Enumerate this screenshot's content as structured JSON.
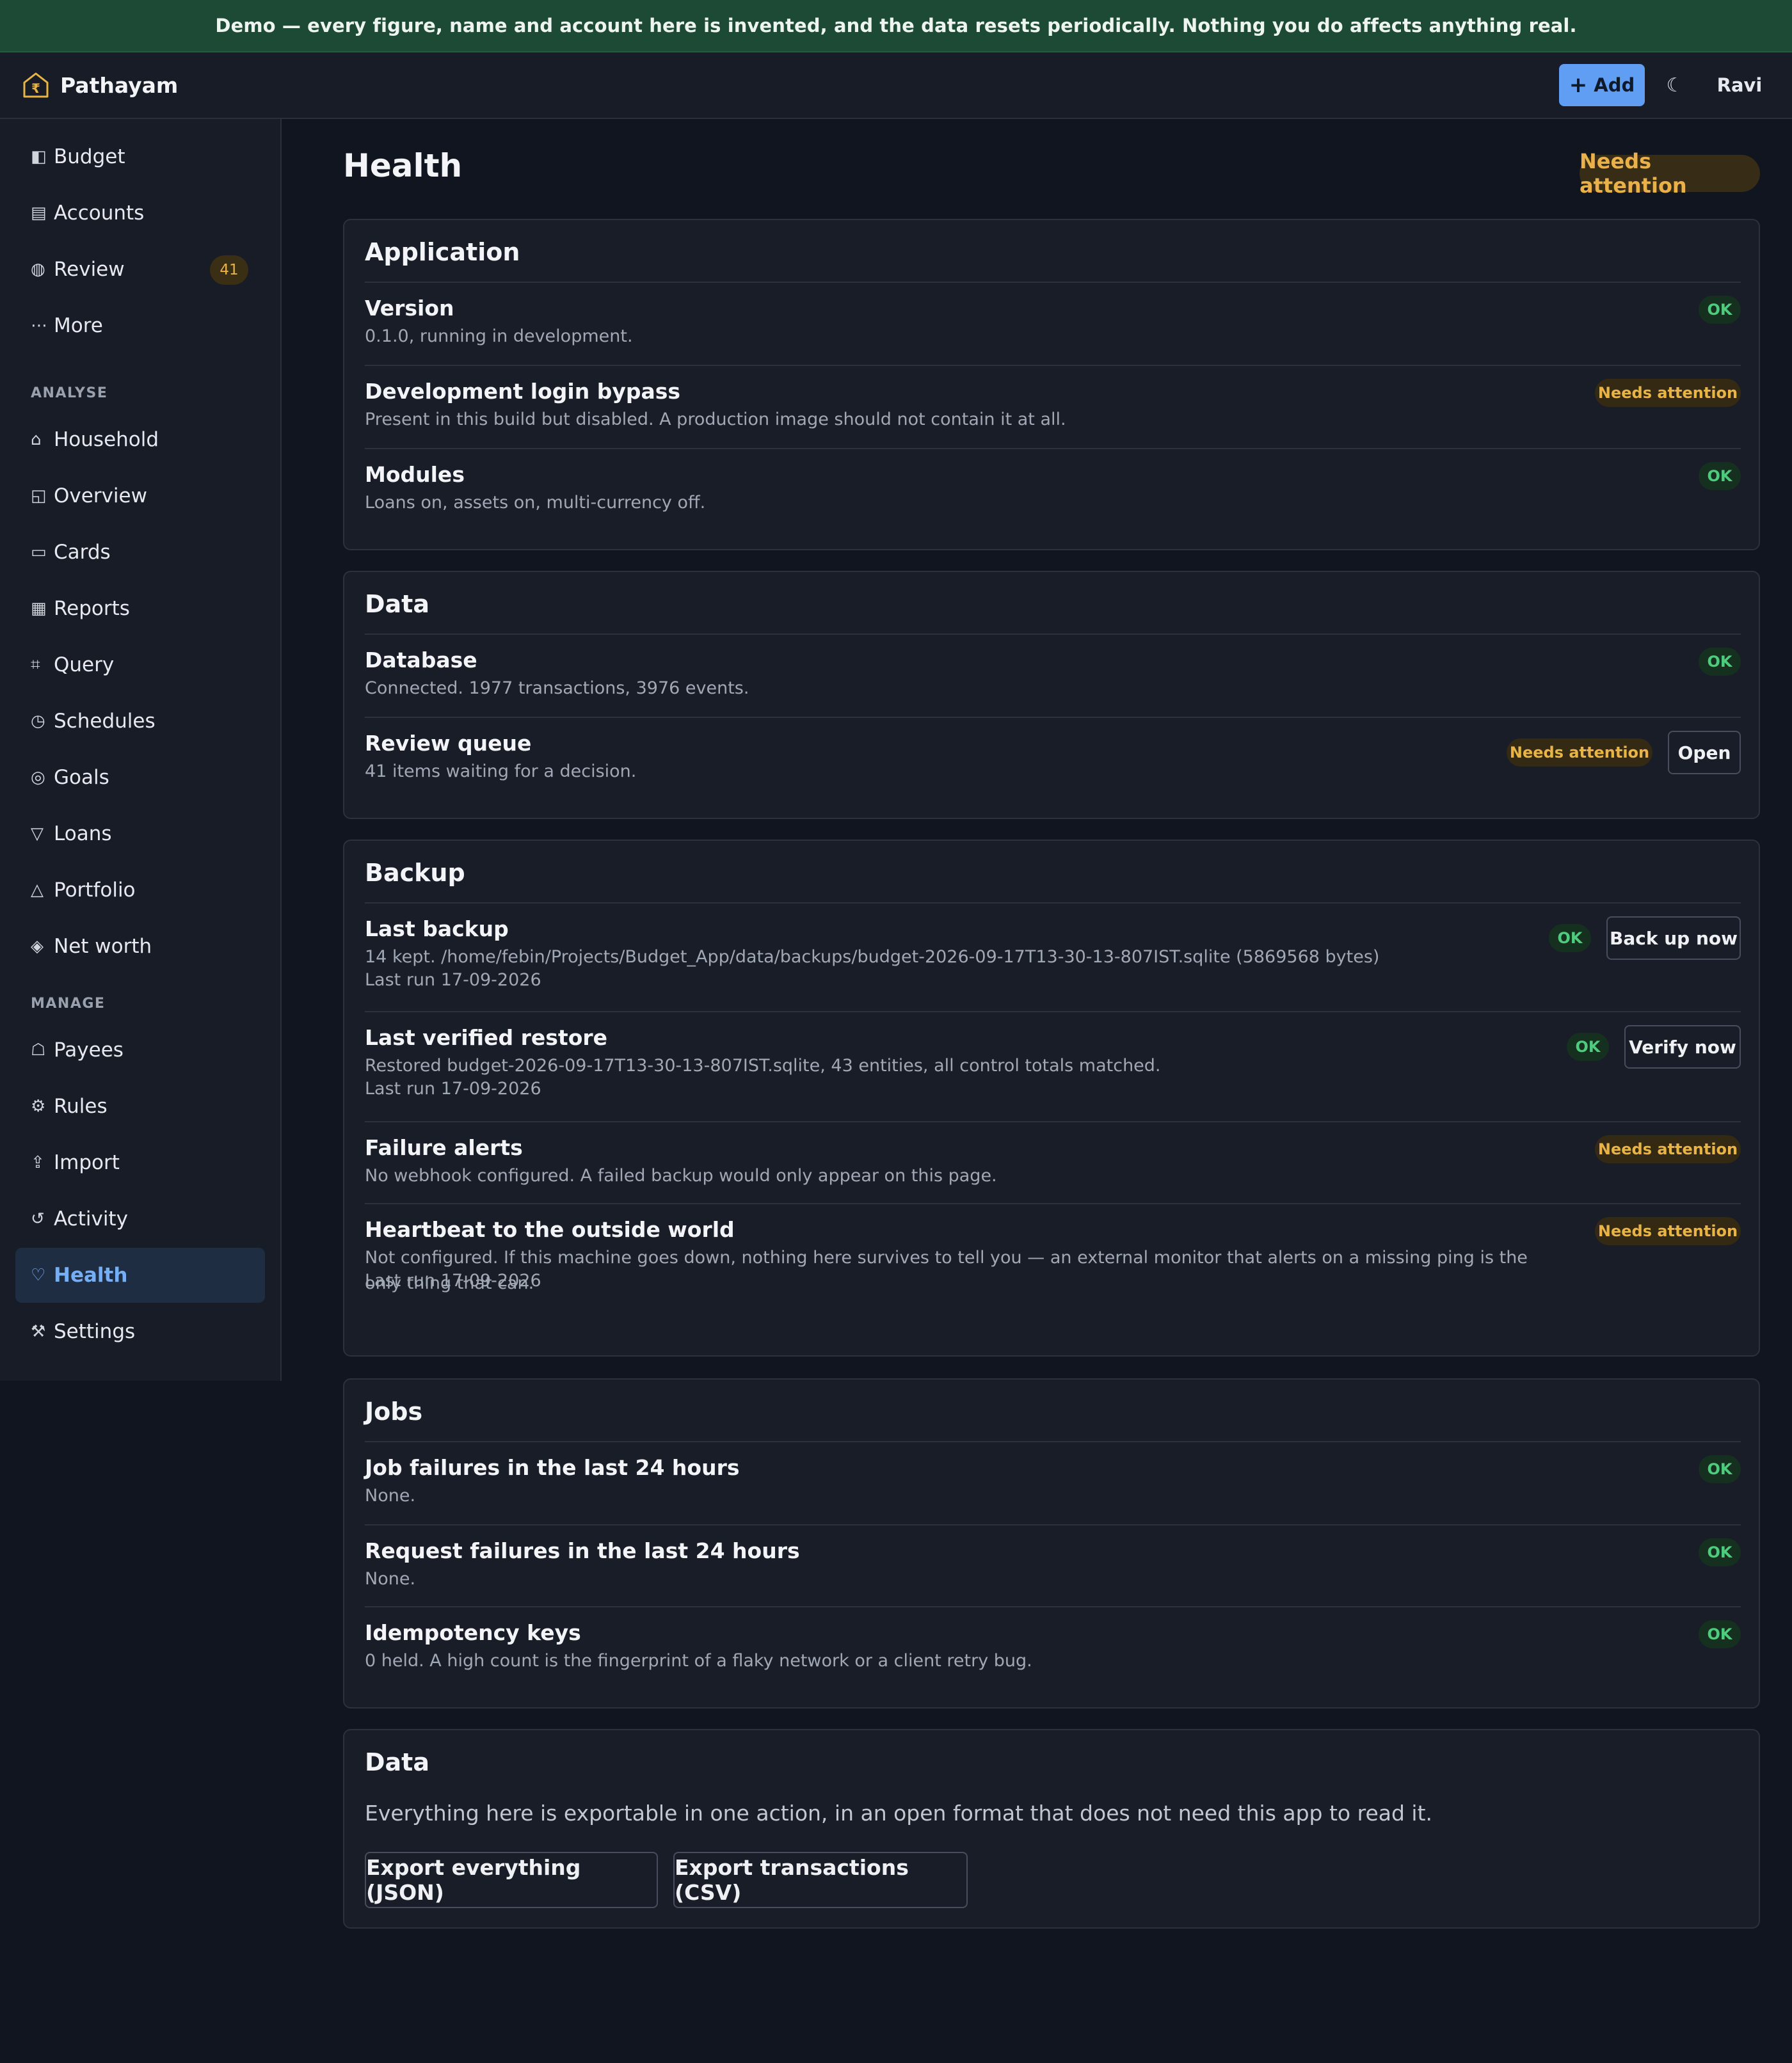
{
  "banner": "Demo — every figure, name and account here is invented, and the data resets periodically. Nothing you do affects anything real.",
  "topbar": {
    "brand": "Pathayam",
    "brand_icon": "house-rupee-icon",
    "add_label": "Add",
    "theme_icon": "☾",
    "user": "Ravi"
  },
  "sidebar": {
    "primary": [
      {
        "icon": "◧",
        "label": "Budget"
      },
      {
        "icon": "▤",
        "label": "Accounts"
      },
      {
        "icon": "◍",
        "label": "Review",
        "badge": "41"
      },
      {
        "icon": "⋯",
        "label": "More"
      }
    ],
    "analyse_label": "ANALYSE",
    "analyse": [
      {
        "icon": "⌂",
        "label": "Household"
      },
      {
        "icon": "◱",
        "label": "Overview"
      },
      {
        "icon": "▭",
        "label": "Cards"
      },
      {
        "icon": "▦",
        "label": "Reports"
      },
      {
        "icon": "⌗",
        "label": "Query"
      },
      {
        "icon": "◷",
        "label": "Schedules"
      },
      {
        "icon": "◎",
        "label": "Goals"
      },
      {
        "icon": "▽",
        "label": "Loans"
      },
      {
        "icon": "△",
        "label": "Portfolio"
      },
      {
        "icon": "◈",
        "label": "Net worth"
      }
    ],
    "manage_label": "MANAGE",
    "manage": [
      {
        "icon": "☖",
        "label": "Payees"
      },
      {
        "icon": "⚙",
        "label": "Rules"
      },
      {
        "icon": "⇪",
        "label": "Import"
      },
      {
        "icon": "↺",
        "label": "Activity"
      },
      {
        "icon": "♡",
        "label": "Health"
      },
      {
        "icon": "⚒",
        "label": "Settings"
      }
    ]
  },
  "page": {
    "title": "Health",
    "status": "Needs attention"
  },
  "status_labels": {
    "ok": "OK",
    "warn": "Needs attention"
  },
  "sections": [
    {
      "title": "Application",
      "rows": [
        {
          "title": "Version",
          "desc": "0.1.0, running in development.",
          "status": "OK"
        },
        {
          "title": "Development login bypass",
          "desc": "Present in this build but disabled. A production image should not contain it at all.",
          "status": "Needs attention"
        },
        {
          "title": "Modules",
          "desc": "Loans on, assets on, multi-currency off.",
          "status": "OK"
        }
      ]
    },
    {
      "title": "Data",
      "rows": [
        {
          "title": "Database",
          "desc": "Connected. 1977 transactions, 3976 events.",
          "status": "OK"
        },
        {
          "title": "Review queue",
          "desc": "41 items waiting for a decision.",
          "status": "Needs attention",
          "action": "Open"
        }
      ]
    },
    {
      "title": "Backup",
      "rows": [
        {
          "title": "Last backup",
          "desc": "14 kept. /home/febin/Projects/Budget_App/data/backups/budget-2026-09-17T13-30-13-807IST.sqlite (5869568 bytes)",
          "sub": "Last run 17-09-2026",
          "status": "OK",
          "action": "Back up now"
        },
        {
          "title": "Last verified restore",
          "desc": "Restored budget-2026-09-17T13-30-13-807IST.sqlite, 43 entities, all control totals matched.",
          "sub": "Last run 17-09-2026",
          "status": "OK",
          "action": "Verify now"
        },
        {
          "title": "Failure alerts",
          "desc": "No webhook configured. A failed backup would only appear on this page.",
          "status": "Needs attention"
        },
        {
          "title": "Heartbeat to the outside world",
          "desc": "Not configured. If this machine goes down, nothing here survives to tell you — an external monitor that alerts on a missing ping is the only thing that can.",
          "sub": "Last run 17-09-2026",
          "status": "Needs attention"
        }
      ]
    },
    {
      "title": "Jobs",
      "rows": [
        {
          "title": "Job failures in the last 24 hours",
          "desc": "None.",
          "status": "OK"
        },
        {
          "title": "Request failures in the last 24 hours",
          "desc": "None.",
          "status": "OK"
        },
        {
          "title": "Idempotency keys",
          "desc": "0 held. A high count is the fingerprint of a flaky network or a client retry bug.",
          "status": "OK"
        }
      ]
    }
  ],
  "export": {
    "title": "Data",
    "text": "Everything here is exportable in one action, in an open format that does not need this app to read it.",
    "json_label": "Export everything (JSON)",
    "csv_label": "Export transactions (CSV)"
  },
  "colors": {
    "accent": "#5f9ef2",
    "ok": "#4fcb7e",
    "warn": "#e8b446",
    "banner": "#1c4a34"
  }
}
